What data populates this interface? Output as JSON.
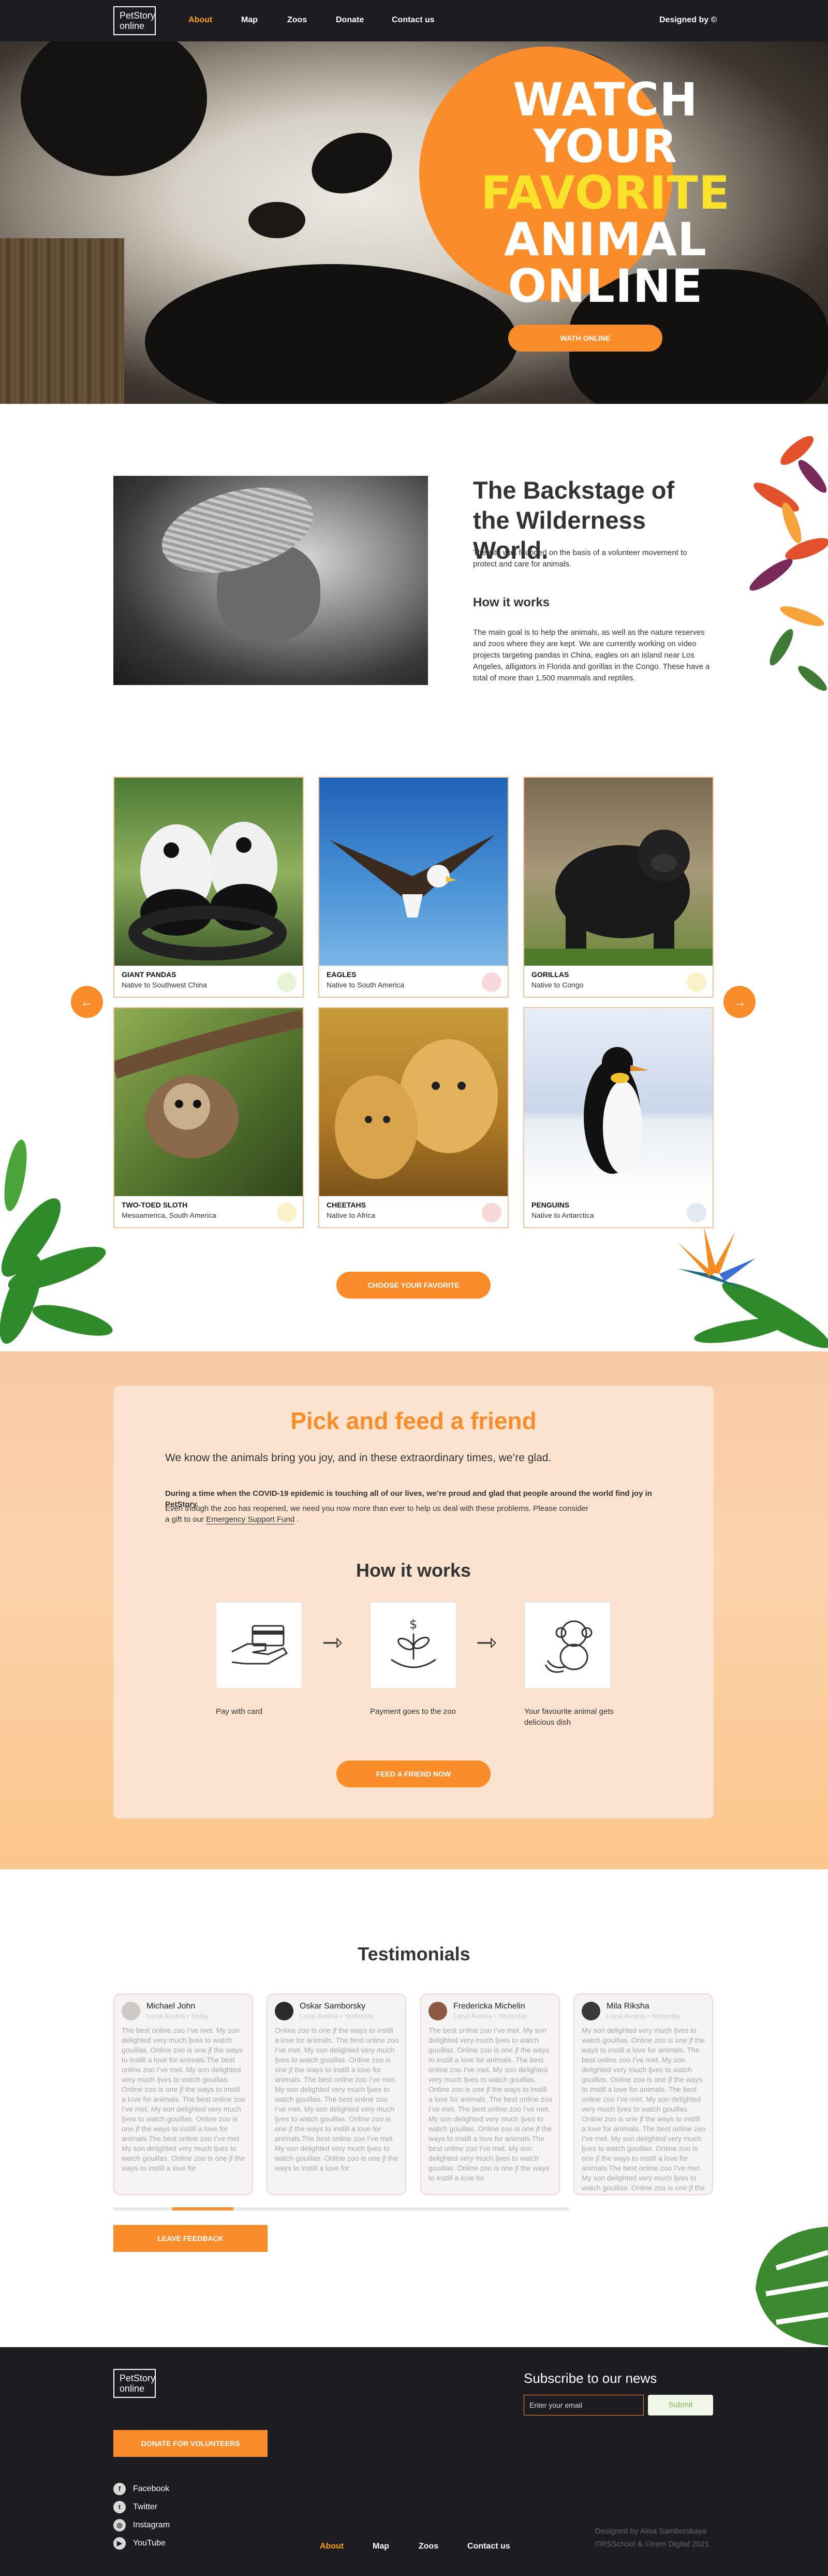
{
  "header": {
    "logo_line1": "PetStory",
    "logo_line2": "online",
    "nav": [
      {
        "label": "About",
        "active": true
      },
      {
        "label": "Map",
        "active": false
      },
      {
        "label": "Zoos",
        "active": false
      },
      {
        "label": "Donate",
        "active": false
      },
      {
        "label": "Contact us",
        "active": false
      }
    ],
    "designed": "Designed by ©"
  },
  "hero": {
    "line1": "WATCH YOUR",
    "line2": "FAVORITE",
    "line3": "ANIMAL",
    "line4": "ONLINE",
    "button": "WATH ONLINE"
  },
  "about": {
    "heading": "The Backstage of the Wilderness World.",
    "intro": "The site was founded on the basis of a volunteer movement to protect and care for animals.",
    "how_title": "How it works",
    "body": "The main goal is to help the animals, as well as the nature reserves and zoos where they are kept. We are currently working on video projects targeting pandas in China, eagles on an island near Los Angeles, alligators in Florida and gorillas in the Congo. These have a total of more than 1,500 mammals and reptiles."
  },
  "animals": {
    "cards": [
      {
        "name": "GIANT PANDAS",
        "origin": "Native to Southwest China",
        "food_icon": "bamboo-icon"
      },
      {
        "name": "EAGLES",
        "origin": "Native to South America",
        "food_icon": "meat-icon"
      },
      {
        "name": "GORILLAS",
        "origin": "Native to Congo",
        "food_icon": "banana-icon"
      },
      {
        "name": "TWO-TOED SLOTH",
        "origin": "Mesoamerica, South America",
        "food_icon": "banana-icon"
      },
      {
        "name": "CHEETAHS",
        "origin": "Native to Africa",
        "food_icon": "meat-icon"
      },
      {
        "name": "PENGUINS",
        "origin": "Native to Antarctica",
        "food_icon": "fish-icon"
      }
    ],
    "prev": "←",
    "next": "→",
    "button": "CHOOSE YOUR FAVORITE"
  },
  "feed": {
    "heading": "Pick and feed a friend",
    "subheading": "We know the animals bring you joy, and in these extraordinary times, we’re glad.",
    "p1": "During a time when the COVID-19 epidemic is touching all of our lives, we’re proud and glad that people around the world find joy in PetStory.",
    "p2a": "Even though the zoo has reopened, we need you now more than ever to help us deal with these problems. Please consider",
    "p2b_prefix": "a gift to our ",
    "p2b_link": "Emergency Support Fund",
    "p2b_suffix": " .",
    "how_title": "How it works",
    "steps": [
      {
        "caption": "Pay with card",
        "icon": "card-payment-icon"
      },
      {
        "caption": "Payment goes to the zoo",
        "icon": "money-plant-icon"
      },
      {
        "caption": "Your favourite animal gets delicious dish",
        "icon": "monkey-bananas-icon"
      }
    ],
    "button": "FEED A FRIEND NOW"
  },
  "testimonials": {
    "heading": "Testimonials",
    "cards": [
      {
        "name": "Michael John",
        "meta": "Local Austria  •  Today",
        "text": "The best online zoo I’ve met. My son delighted very much ljves to watch gouillas. Online zoo is one jf the ways to instill a love for animals.The best online zoo I’ve met. My son delighted very much ljves to watch gouillas. Online zoo is one jf the ways to instill a love for animals.\nThe best online zoo I’ve met. My son delighted very much ljves to watch gouillas. Online zoo is one jf the ways to instill a love for animals.The best online zoo I’ve met. My son delighted very much ljves to watch gouillas. Online zoo is one jf the ways to instill a love for"
      },
      {
        "name": "Oskar Samborsky",
        "meta": "Local Austria  •  Yesterday",
        "text": "Online zoo is one jf the ways to instill a love for animals. The best online zoo I’ve met. My son delighted very much ljves to watch gouillas. Online zoo is one jf the ways to instill a love for animals. The best online zoo I’ve met. My son delighted very much ljves to watch gouillas.\nThe best online zoo I’ve met. My son delighted very much ljves to watch gouillas. Online zoo is one jf the ways to instill a love for animals.The best online zoo I’ve met. My son delighted very much ljves to watch gouillas. Online zoo is one jf the ways to instill a love for"
      },
      {
        "name": "Fredericka Michelin",
        "meta": "Local Austria  •  Yesterday",
        "text": "The best online zoo I’ve met. My son delighted very much ljves to watch gouillas. Online zoo is one jf the ways to instill a love for animals. The best online zoo I’ve met. My son delighted very much ljves to watch gouillas. Online zoo is one jf the ways to instill a love for animals. The best online zoo I’ve met.\nThe best online zoo I’ve met. My son delighted very much ljves to watch gouillas. Online zoo is one jf the ways to instill a love for animals.The best online zoo I’ve met. My son delighted very much ljves to watch gouillas. Online zoo is one jf the ways to instill a love for"
      },
      {
        "name": "Mila Riksha",
        "meta": "Local Austria  •  Yesterday",
        "text": "My son delighted very much ljves to watch gouillas. Online zoo is one jf the ways to instill a love for animals. The best online zoo I’ve met. My son delighted very much ljves to watch gouillas. Online zoo is one jf the ways to instill a love for animals. The best online zoo I’ve met. My son delighted very much ljves to watch gouillas. Online zoo is one jf the ways to instill a love for animals.\nThe best online zoo I’ve met. My son delighted very much ljves to watch gouillas. Online zoo is one jf the ways to instill a love for animals.The best online zoo I’ve met. My son delighted very much ljves to watch gouillas. Online zoo is one jf the ways to instill a love for"
      }
    ],
    "scroll_progress": 0.13,
    "button": "LEAVE FEEDBACK"
  },
  "footer": {
    "logo_line1": "PetStory",
    "logo_line2": "online",
    "donate_button": "DONATE FOR VOLUNTEERS",
    "subscribe_title": "Subscribe to our news",
    "email_placeholder": "Enter your email",
    "submit": "Submit",
    "social": [
      {
        "label": "Facebook",
        "icon": "facebook-icon",
        "glyph": "f"
      },
      {
        "label": "Twitter",
        "icon": "twitter-icon",
        "glyph": "t"
      },
      {
        "label": "Instagram",
        "icon": "instagram-icon",
        "glyph": "◎"
      },
      {
        "label": "YouTube",
        "icon": "youtube-icon",
        "glyph": "▶"
      }
    ],
    "nav": [
      {
        "label": "About",
        "active": true
      },
      {
        "label": "Map",
        "active": false
      },
      {
        "label": "Zoos",
        "active": false
      },
      {
        "label": "Contact us",
        "active": false
      }
    ],
    "credit1": "Designed by Alisa Samborskaya",
    "credit2": "©RSSchool & ©Irem Digital 2021"
  },
  "colors": {
    "accent": "#fa8c2a",
    "hero_yellow": "#f9e229",
    "dark": "#1d1c21",
    "card_border": "#f4c29b"
  }
}
